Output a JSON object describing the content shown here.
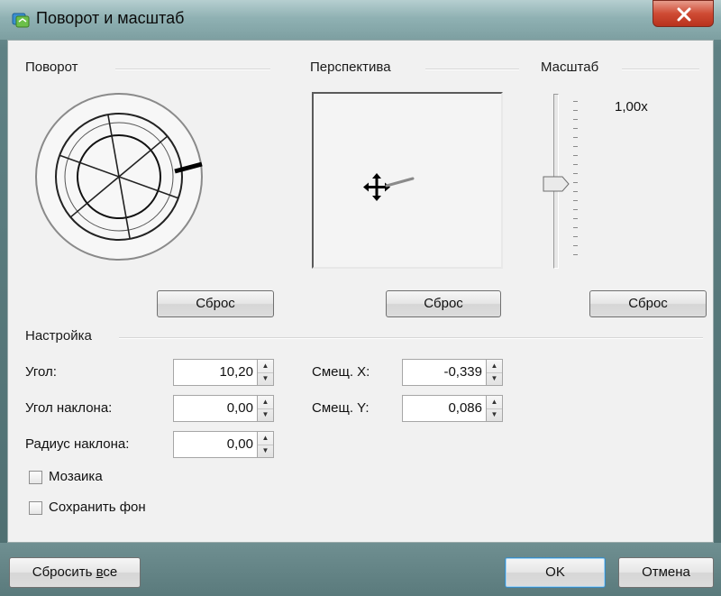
{
  "window": {
    "title": "Поворот и масштаб"
  },
  "groups": {
    "rotation_label": "Поворот",
    "perspective_label": "Перспектива",
    "scale_label": "Масштаб",
    "settings_label": "Настройка"
  },
  "scale": {
    "value_text": "1,00x"
  },
  "reset_buttons": {
    "rotation": "Сброс",
    "perspective": "Сброс",
    "scale": "Сброс"
  },
  "settings": {
    "angle_label": "Угол:",
    "angle_value": "10,20",
    "tilt_angle_label": "Угол наклона:",
    "tilt_angle_value": "0,00",
    "tilt_radius_label": "Радиус наклона:",
    "tilt_radius_value": "0,00",
    "offset_x_label": "Смещ. X:",
    "offset_x_value": "-0,339",
    "offset_y_label": "Смещ. Y:",
    "offset_y_value": "0,086",
    "mosaic_label": "Мозаика",
    "mosaic_checked": false,
    "keep_background_label": "Сохранить фон",
    "keep_background_checked": false
  },
  "footer": {
    "reset_all_prefix": "Сбросить ",
    "reset_all_accel": "в",
    "reset_all_suffix": "се",
    "ok_label": "OK",
    "cancel_label": "Отмена"
  }
}
